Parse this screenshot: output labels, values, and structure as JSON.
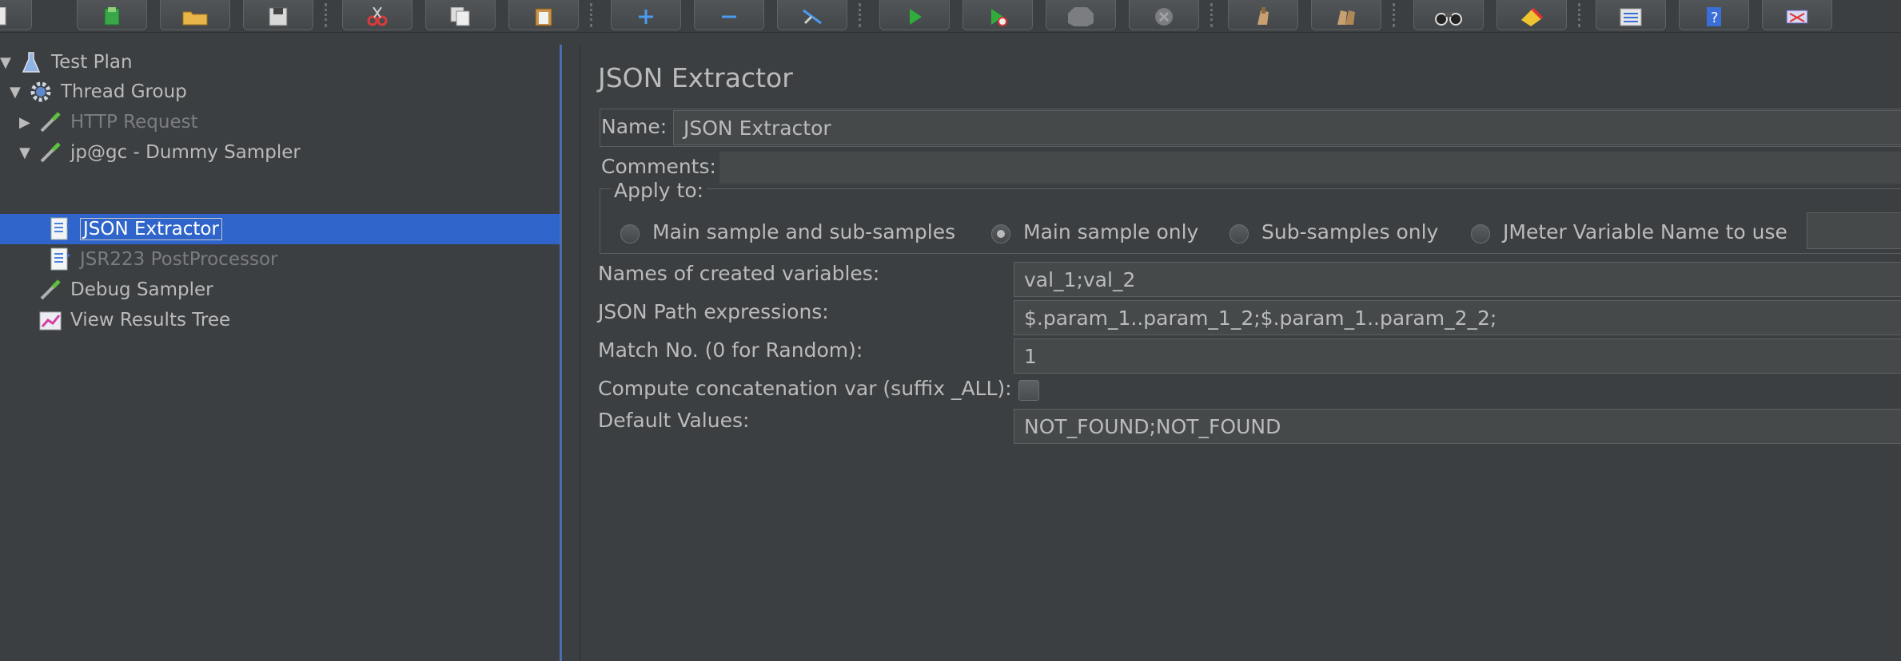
{
  "tree": {
    "items": [
      {
        "label": "Test Plan",
        "icon": "flask-icon"
      },
      {
        "label": "Thread Group",
        "icon": "gear-icon"
      },
      {
        "label": "HTTP Request",
        "icon": "pipette-icon"
      },
      {
        "label": "jp@gc - Dummy Sampler",
        "icon": "pipette-icon"
      },
      {
        "label": "JSON Extractor",
        "icon": "document-icon"
      },
      {
        "label": "JSR223 PostProcessor",
        "icon": "document-icon"
      },
      {
        "label": "Debug Sampler",
        "icon": "pipette-icon"
      },
      {
        "label": "View Results Tree",
        "icon": "chart-icon"
      }
    ]
  },
  "panel": {
    "title": "JSON Extractor",
    "name_label": "Name:",
    "name_value": "JSON Extractor",
    "comments_label": "Comments:",
    "apply_to": {
      "label": "Apply to:",
      "options": [
        "Main sample and sub-samples",
        "Main sample only",
        "Sub-samples only",
        "JMeter Variable Name to use"
      ],
      "selected": "Main sample only"
    },
    "fields": {
      "names_label": "Names of created variables:",
      "names_value": "val_1;val_2",
      "paths_label": "JSON Path expressions:",
      "paths_value": "$.param_1..param_1_2;$.param_1..param_2_2;",
      "match_label": "Match No. (0 for Random):",
      "match_value": "1",
      "concat_label": "Compute concatenation var (suffix _ALL):",
      "concat_checked": false,
      "defaults_label": "Default Values:",
      "defaults_value": "NOT_FOUND;NOT_FOUND"
    }
  },
  "toolbar": {
    "icons": [
      "new-icon",
      "templates-icon",
      "open-icon",
      "save-icon",
      "cut-icon",
      "copy-icon",
      "paste-icon",
      "expand-icon",
      "collapse-icon",
      "toggle-icon",
      "start-icon",
      "start-no-timers-icon",
      "stop-icon",
      "shutdown-icon",
      "clear-icon",
      "clear-all-icon",
      "search-icon",
      "reset-search-icon",
      "function-helper-icon",
      "help-icon",
      "remote-icon"
    ]
  },
  "colors": {
    "background": "#3c3f41",
    "selection": "#2f65ca",
    "field": "#45494a",
    "text": "#bbbbbb"
  }
}
